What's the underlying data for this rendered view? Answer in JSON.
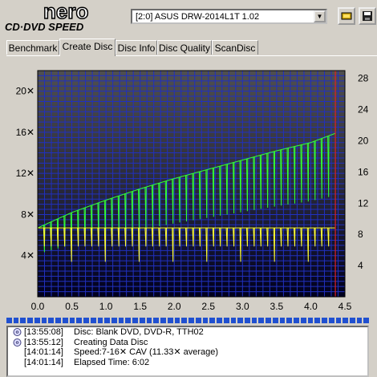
{
  "app": {
    "logo_text": "nero",
    "logo_sub": "CD·DVD SPEED"
  },
  "drive": {
    "selected": "[2:0]  ASUS DRW-2014L1T 1.02"
  },
  "toolbar": {
    "icon1": "drive-icon",
    "icon2": "save-icon"
  },
  "tabs": [
    {
      "label": "Benchmark"
    },
    {
      "label": "Create Disc"
    },
    {
      "label": "Disc Info"
    },
    {
      "label": "Disc Quality"
    },
    {
      "label": "ScanDisc"
    }
  ],
  "active_tab": "Create Disc",
  "progress": 1.0,
  "log": [
    {
      "time": "[13:55:08]",
      "msg": "Disc: Blank DVD, DVD-R, TTH02",
      "icon": true
    },
    {
      "time": "[13:55:12]",
      "msg": "Creating Data Disc",
      "icon": true
    },
    {
      "time": "[14:01:14]",
      "msg": "Speed:7-16✕ CAV (11.33✕ average)",
      "icon": false
    },
    {
      "time": "[14:01:14]",
      "msg": "Elapsed Time:  6:02",
      "icon": false
    }
  ],
  "chart_data": {
    "type": "line",
    "xlim": [
      0,
      4.5
    ],
    "ylim_left": [
      0,
      22
    ],
    "ylim_right": [
      0,
      29
    ],
    "x_ticks": [
      "0.0",
      "0.5",
      "1.0",
      "1.5",
      "2.0",
      "2.5",
      "3.0",
      "3.5",
      "4.0",
      "4.5"
    ],
    "y_left_ticks": [
      "4✕",
      "8✕",
      "12✕",
      "16✕",
      "20✕"
    ],
    "y_right_ticks": [
      "4",
      "8",
      "12",
      "16",
      "20",
      "24",
      "28"
    ],
    "series": [
      {
        "color": "#33ff33",
        "x": [
          0.0,
          0.5,
          1.0,
          1.5,
          2.0,
          2.5,
          3.0,
          3.5,
          4.0,
          4.36
        ],
        "y": [
          6.7,
          8.2,
          9.4,
          10.5,
          11.5,
          12.4,
          13.3,
          14.2,
          15.0,
          15.9
        ]
      },
      {
        "color": "#ffff33",
        "x": [
          0.0,
          0.5,
          1.0,
          1.5,
          2.0,
          2.5,
          3.0,
          3.5,
          4.0,
          4.36
        ],
        "y": [
          6.7,
          6.7,
          6.7,
          6.7,
          6.7,
          6.7,
          6.7,
          6.7,
          6.7,
          6.7
        ]
      }
    ],
    "marker_x": 4.36,
    "marker_color": "#e02020"
  }
}
